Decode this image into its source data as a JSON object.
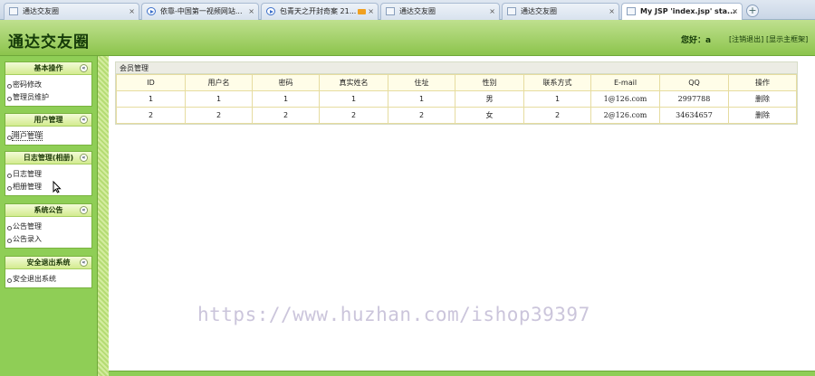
{
  "tabs": [
    {
      "label": "通达交友圈",
      "icon": "page-icon",
      "active": false
    },
    {
      "label": "依靠-中国第一视频网站...",
      "icon": "play-icon",
      "active": false
    },
    {
      "label": "包青天之开封奇案 21...",
      "icon": "play-icon",
      "active": false,
      "badge": "video-icon"
    },
    {
      "label": "通达交友圈",
      "icon": "page-icon",
      "active": false
    },
    {
      "label": "通达交友圈",
      "icon": "page-icon",
      "active": false
    },
    {
      "label": "My JSP 'index.jsp' sta...",
      "icon": "page-icon",
      "active": true
    }
  ],
  "tab_close": "×",
  "new_tab": "+",
  "header": {
    "title": "通达交友圈",
    "greeting": "您好：a",
    "logout_link": "[注销退出]",
    "show_frame_link": "[显示主框架]"
  },
  "sidebar": {
    "groups": [
      {
        "title": "基本操作",
        "toggle": "«",
        "items": [
          "密码修改",
          "管理员维护"
        ]
      },
      {
        "title": "用户管理",
        "toggle": "«",
        "items": [
          "用户管理"
        ]
      },
      {
        "title": "日志管理(相册)",
        "toggle": "«",
        "items": [
          "日志管理",
          "相册管理"
        ]
      },
      {
        "title": "系统公告",
        "toggle": "«",
        "items": [
          "公告管理",
          "公告录入"
        ]
      },
      {
        "title": "安全退出系统",
        "toggle": "«",
        "items": [
          "安全退出系统"
        ]
      }
    ]
  },
  "panel": {
    "title": "会员管理",
    "columns": [
      "ID",
      "用户名",
      "密码",
      "真实姓名",
      "住址",
      "性别",
      "联系方式",
      "E-mail",
      "QQ",
      "操作"
    ],
    "rows": [
      [
        "1",
        "1",
        "1",
        "1",
        "1",
        "男",
        "1",
        "1@126.com",
        "2997788",
        "删除"
      ],
      [
        "2",
        "2",
        "2",
        "2",
        "2",
        "女",
        "2",
        "2@126.com",
        "34634657",
        "删除"
      ]
    ]
  },
  "watermark": "https://www.huzhan.com/ishop39397",
  "colors": {
    "header_top": "#bfe08f",
    "header_bottom": "#8cc44c",
    "sidebar": "#8fce56",
    "table_border": "#e6dca0"
  }
}
